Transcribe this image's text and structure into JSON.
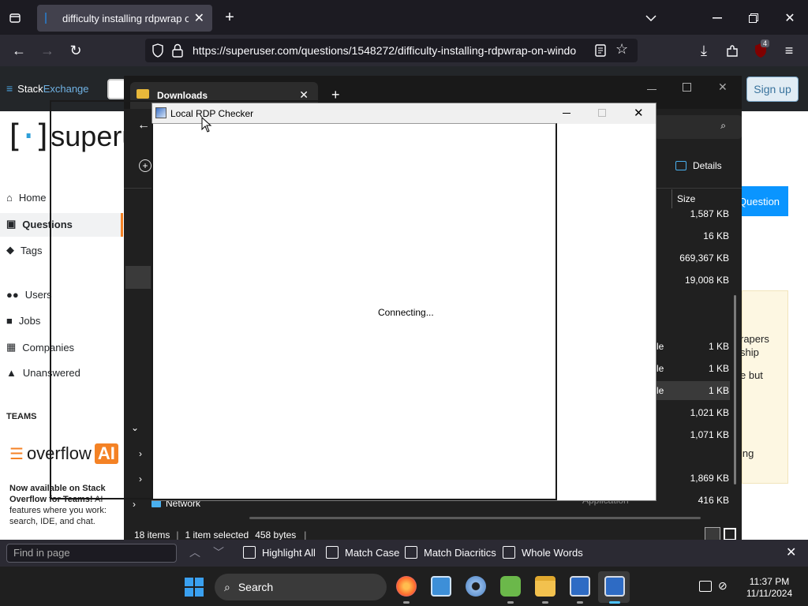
{
  "browser": {
    "tab_title": "difficulty installing rdpwrap on",
    "new_tab": "+",
    "url": "https://superuser.com/questions/1548272/difficulty-installing-rdpwrap-on-windo",
    "extension_badge": "4"
  },
  "site": {
    "network_name_a": "Stack",
    "network_name_b": "Exchange",
    "logo_text": "superu",
    "signup_label": "Sign up",
    "ask_label": "Question",
    "nav": [
      {
        "label": "Home"
      },
      {
        "label": "Questions"
      },
      {
        "label": "Tags"
      },
      {
        "label": "Users"
      },
      {
        "label": "Jobs"
      },
      {
        "label": "Companies"
      },
      {
        "label": "Unanswered"
      }
    ],
    "teams_heading": "TEAMS",
    "overflow_ai_a": "overflow",
    "overflow_ai_b": "AI",
    "promo_bold": "Now available on Stack Overflow for Teams!",
    "promo_text": "AI features where you work: search, IDE, and chat.",
    "side_snippets": [
      "rapers",
      "ship",
      "e but",
      "ing"
    ]
  },
  "explorer": {
    "tab_title": "Downloads",
    "details_label": "Details",
    "size_header": "Size",
    "sizes": [
      "1,587 KB",
      "16 KB",
      "669,367 KB",
      "19,008 KB",
      "1 KB",
      "1 KB",
      "1 KB",
      "1,021 KB",
      "1,071 KB",
      "1,869 KB",
      "416 KB"
    ],
    "type_fragments": [
      "le",
      "le",
      "le"
    ],
    "network_label": "Network",
    "bottom_row_type": "Application",
    "status_items": "18 items",
    "status_selected": "1 item selected",
    "status_size": "458 bytes"
  },
  "rdp_checker": {
    "title": "Local RDP Checker",
    "status_text": "Connecting..."
  },
  "findbar": {
    "placeholder": "Find in page",
    "highlight_all": "Highlight All",
    "match_case": "Match Case",
    "match_diacritics": "Match Diacritics",
    "whole_words": "Whole Words"
  },
  "taskbar": {
    "search_label": "Search",
    "time": "11:37 PM",
    "date": "11/11/2024"
  },
  "colors": {
    "browser_dark": "#1c1b22",
    "so_orange": "#f48225",
    "so_blue": "#0a95ff"
  }
}
